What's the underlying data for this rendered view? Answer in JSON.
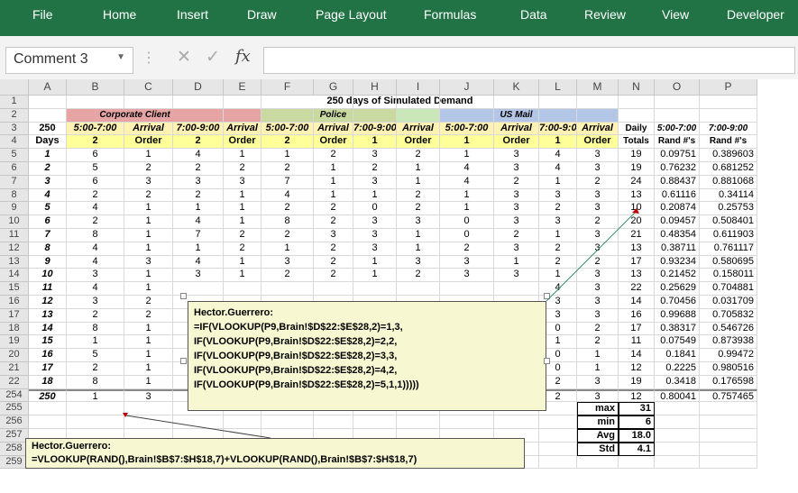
{
  "ribbon": {
    "tabs": [
      "File",
      "Home",
      "Insert",
      "Draw",
      "Page Layout",
      "Formulas",
      "Data",
      "Review",
      "View",
      "Developer"
    ]
  },
  "formula_bar": {
    "name_box": "Comment 3",
    "fx_label": "fx",
    "formula_value": ""
  },
  "sheet": {
    "columns": [
      "A",
      "B",
      "C",
      "D",
      "E",
      "F",
      "G",
      "H",
      "I",
      "J",
      "K",
      "L",
      "M",
      "N",
      "O",
      "P"
    ],
    "title": "250 days of Simulated Demand",
    "groups": {
      "corporate": "Corporate Client",
      "police": "Police",
      "usmail": "US Mail"
    },
    "row3": [
      "250",
      "5:00-7:00",
      "Arrival",
      "7:00-9:00",
      "Arrival",
      "5:00-7:00",
      "Arrival",
      "7:00-9:00",
      "Arrival",
      "5:00-7:00",
      "Arrival",
      "7:00-9:00",
      "Arrival",
      "Daily",
      "5:00-7:00",
      "7:00-9:00"
    ],
    "row4": [
      "Days",
      "2",
      "Order",
      "2",
      "Order",
      "2",
      "Order",
      "1",
      "Order",
      "1",
      "Order",
      "1",
      "Order",
      "Totals",
      "Rand #'s",
      "Rand #'s"
    ],
    "row_numbers": [
      "1",
      "2",
      "3",
      "4",
      "5",
      "6",
      "7",
      "8",
      "9",
      "10",
      "11",
      "12",
      "13",
      "14",
      "15",
      "16",
      "17",
      "18",
      "19",
      "20",
      "21",
      "22",
      "254",
      "255",
      "256",
      "257",
      "258",
      "259"
    ],
    "data_rows": [
      [
        "1",
        "6",
        "1",
        "4",
        "1",
        "1",
        "2",
        "3",
        "2",
        "1",
        "3",
        "4",
        "3",
        "19",
        "0.09751",
        "0.389603"
      ],
      [
        "2",
        "5",
        "2",
        "2",
        "2",
        "2",
        "1",
        "2",
        "1",
        "4",
        "3",
        "4",
        "3",
        "19",
        "0.76232",
        "0.681252"
      ],
      [
        "3",
        "6",
        "3",
        "3",
        "3",
        "7",
        "1",
        "3",
        "1",
        "4",
        "2",
        "1",
        "2",
        "24",
        "0.88437",
        "0.881068"
      ],
      [
        "4",
        "2",
        "2",
        "2",
        "1",
        "4",
        "1",
        "1",
        "2",
        "1",
        "3",
        "3",
        "3",
        "13",
        "0.61116",
        "0.34114"
      ],
      [
        "5",
        "4",
        "1",
        "1",
        "1",
        "2",
        "2",
        "0",
        "2",
        "1",
        "3",
        "2",
        "3",
        "10",
        "0.20874",
        "0.25753"
      ],
      [
        "6",
        "2",
        "1",
        "4",
        "1",
        "8",
        "2",
        "3",
        "3",
        "0",
        "3",
        "3",
        "2",
        "20",
        "0.09457",
        "0.508401"
      ],
      [
        "7",
        "8",
        "1",
        "7",
        "2",
        "2",
        "3",
        "3",
        "1",
        "0",
        "2",
        "1",
        "3",
        "21",
        "0.48354",
        "0.611903"
      ],
      [
        "8",
        "4",
        "1",
        "1",
        "2",
        "1",
        "2",
        "3",
        "1",
        "2",
        "3",
        "2",
        "3",
        "13",
        "0.38711",
        "0.761117"
      ],
      [
        "9",
        "4",
        "3",
        "4",
        "1",
        "3",
        "2",
        "1",
        "3",
        "3",
        "1",
        "2",
        "2",
        "17",
        "0.93234",
        "0.580695"
      ],
      [
        "10",
        "3",
        "1",
        "3",
        "1",
        "2",
        "2",
        "1",
        "2",
        "3",
        "3",
        "1",
        "3",
        "13",
        "0.21452",
        "0.158011"
      ],
      [
        "11",
        "4",
        "1",
        "",
        "",
        "",
        "",
        "",
        "",
        "",
        "",
        "4",
        "3",
        "22",
        "0.25629",
        "0.704881"
      ],
      [
        "12",
        "3",
        "2",
        "",
        "",
        "",
        "",
        "",
        "",
        "",
        "",
        "3",
        "3",
        "14",
        "0.70456",
        "0.031709"
      ],
      [
        "13",
        "2",
        "2",
        "",
        "",
        "",
        "",
        "",
        "",
        "",
        "",
        "3",
        "3",
        "16",
        "0.99688",
        "0.705832"
      ],
      [
        "14",
        "8",
        "1",
        "",
        "",
        "",
        "",
        "",
        "",
        "",
        "",
        "0",
        "2",
        "17",
        "0.38317",
        "0.546726"
      ],
      [
        "15",
        "1",
        "1",
        "",
        "",
        "",
        "",
        "",
        "",
        "",
        "",
        "1",
        "2",
        "11",
        "0.07549",
        "0.873938"
      ],
      [
        "16",
        "5",
        "1",
        "",
        "",
        "",
        "",
        "",
        "",
        "",
        "",
        "0",
        "1",
        "14",
        "0.1841",
        "0.99472"
      ],
      [
        "17",
        "2",
        "1",
        "",
        "",
        "",
        "",
        "",
        "",
        "",
        "",
        "0",
        "1",
        "12",
        "0.2225",
        "0.980516"
      ],
      [
        "18",
        "8",
        "1",
        "",
        "",
        "",
        "",
        "",
        "",
        "",
        "",
        "2",
        "3",
        "19",
        "0.3418",
        "0.176598"
      ]
    ],
    "row254": [
      "250",
      "1",
      "3",
      "4",
      "2",
      "1",
      "1",
      "3",
      "1",
      "1",
      "2",
      "2",
      "3",
      "12",
      "0.80041",
      "0.757465"
    ],
    "stats": [
      {
        "label": "max",
        "value": "31"
      },
      {
        "label": "min",
        "value": "6"
      },
      {
        "label": "Avg",
        "value": "18.0"
      },
      {
        "label": "Std",
        "value": "4.1"
      }
    ]
  },
  "comments": {
    "comment_vlookup": {
      "author": "Hector.Guerrero:",
      "lines": [
        "=IF(VLOOKUP(P9,Brain!$D$22:$E$28,2)=1,3,",
        "IF(VLOOKUP(P9,Brain!$D$22:$E$28,2)=2,2,",
        "IF(VLOOKUP(P9,Brain!$D$22:$E$28,2)=3,3,",
        "IF(VLOOKUP(P9,Brain!$D$22:$E$28,2)=4,2,",
        "IF(VLOOKUP(P9,Brain!$D$22:$E$28,2)=5,1,1)))))"
      ]
    },
    "comment_rand": {
      "author": "Hector.Guerrero:",
      "lines": [
        "=VLOOKUP(RAND(),Brain!$B$7:$H$18,7)+VLOOKUP(RAND(),Brain!$B$7:$H$18,7)"
      ]
    }
  },
  "colors": {
    "ribbon": "#217346",
    "corporate": "#e6a4a4",
    "police": "#c9d9a0",
    "police_light": "#c9e6b8",
    "usmail": "#b4c6e7",
    "row3_yellow": "#fff2b3",
    "row4_yellow": "#ffff99",
    "comment_bg": "#f7f7d1"
  }
}
